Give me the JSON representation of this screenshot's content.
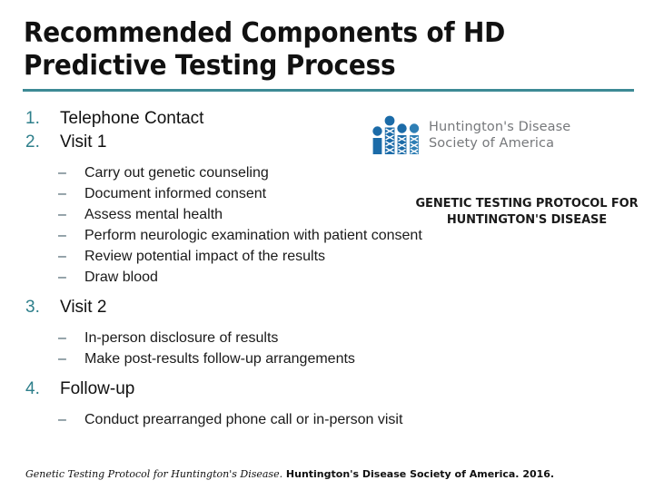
{
  "slide": {
    "title": "Recommended Components of HD Predictive Testing Process",
    "accent_color": "#3d8a95",
    "number_color": "#2e7f8b",
    "background": "#ffffff"
  },
  "outline": [
    {
      "level": 1,
      "marker": "1.",
      "text": "Telephone Contact"
    },
    {
      "level": 1,
      "marker": "2.",
      "text": "Visit 1"
    },
    {
      "level": 2,
      "marker": "–",
      "text": "Carry out genetic counseling"
    },
    {
      "level": 2,
      "marker": "–",
      "text": "Document informed consent"
    },
    {
      "level": 2,
      "marker": "–",
      "text": "Assess mental health"
    },
    {
      "level": 2,
      "marker": "–",
      "text": "Perform neurologic examination with patient consent"
    },
    {
      "level": 2,
      "marker": "–",
      "text": "Review potential impact of the results"
    },
    {
      "level": 2,
      "marker": "–",
      "text": "Draw blood"
    },
    {
      "level": 1,
      "marker": "3.",
      "text": "Visit 2"
    },
    {
      "level": 2,
      "marker": "–",
      "text": "In-person disclosure of results"
    },
    {
      "level": 2,
      "marker": "–",
      "text": "Make post-results follow-up arrangements"
    },
    {
      "level": 1,
      "marker": "4.",
      "text": "Follow-up"
    },
    {
      "level": 2,
      "marker": "–",
      "text": "Conduct prearranged phone call or in-person visit"
    }
  ],
  "logo": {
    "icon_name": "hdsa-people-logo-icon",
    "wordmark": "Huntington's Disease\nSociety of America",
    "mark_color": "#1b6ba8",
    "mark_color_light": "#4a90c4",
    "wordmark_color": "#76787b"
  },
  "protocol_heading": {
    "text": "GENETIC TESTING PROTOCOL FOR\nHUNTINGTON'S DISEASE"
  },
  "citation": {
    "italic_part": "Genetic Testing Protocol for Huntington's Disease.",
    "bold_part": " Huntington's Disease Society of America. 2016."
  }
}
